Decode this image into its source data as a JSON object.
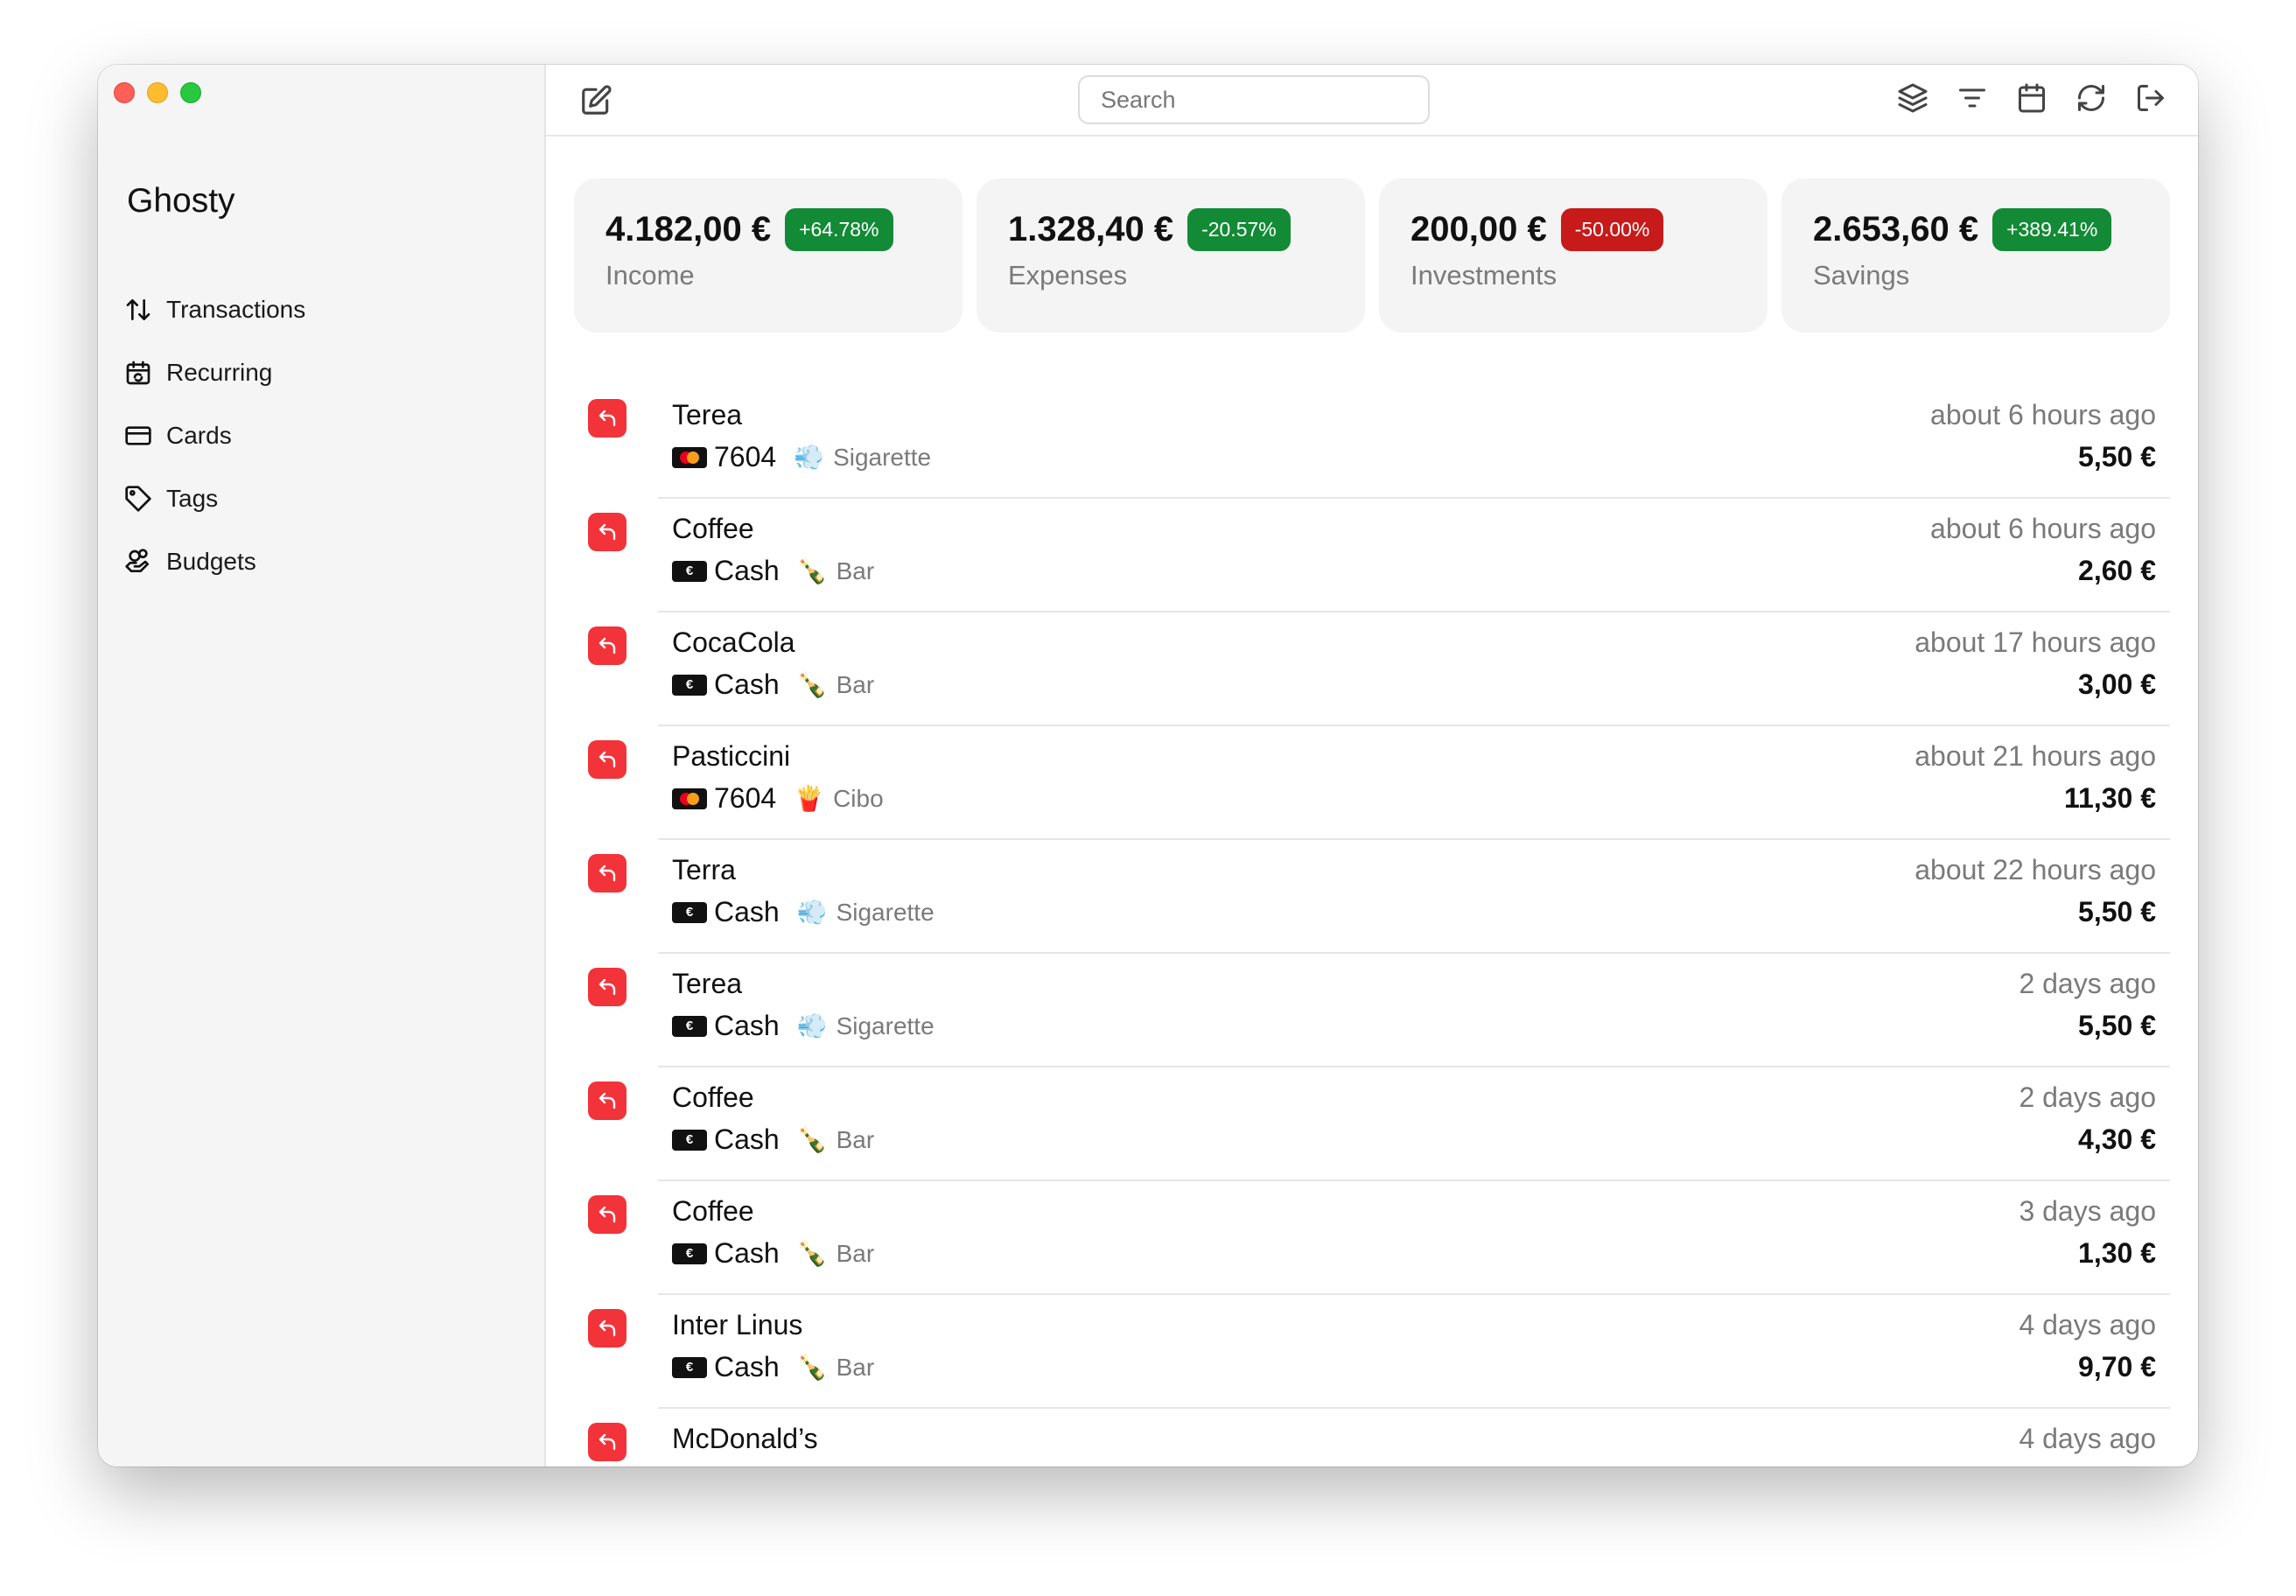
{
  "app": {
    "title": "Ghosty"
  },
  "sidebar": {
    "items": [
      {
        "label": "Transactions",
        "icon": "arrows-up-down-icon"
      },
      {
        "label": "Recurring",
        "icon": "calendar-repeat-icon"
      },
      {
        "label": "Cards",
        "icon": "credit-card-icon"
      },
      {
        "label": "Tags",
        "icon": "tag-icon"
      },
      {
        "label": "Budgets",
        "icon": "coins-hand-icon"
      }
    ]
  },
  "toolbar": {
    "search_placeholder": "Search",
    "icons": [
      "layers-icon",
      "filter-icon",
      "calendar-icon",
      "refresh-icon",
      "logout-icon"
    ]
  },
  "stats": [
    {
      "amount": "4.182,00 €",
      "change": "+64.78%",
      "label": "Income",
      "badge_color": "#138a36"
    },
    {
      "amount": "1.328,40 €",
      "change": "-20.57%",
      "label": "Expenses",
      "badge_color": "#138a36"
    },
    {
      "amount": "200,00 €",
      "change": "-50.00%",
      "label": "Investments",
      "badge_color": "#c71a1a"
    },
    {
      "amount": "2.653,60 €",
      "change": "+389.41%",
      "label": "Savings",
      "badge_color": "#138a36"
    }
  ],
  "transactions": [
    {
      "name": "Terea",
      "card": "mastercard",
      "method": "7604",
      "tag_emoji": "💨",
      "tag": "Sigarette",
      "time": "about 6 hours ago",
      "amount": "5,50 €"
    },
    {
      "name": "Coffee",
      "card": "cash",
      "method": "Cash",
      "tag_emoji": "🍾",
      "tag": "Bar",
      "time": "about 6 hours ago",
      "amount": "2,60 €"
    },
    {
      "name": "CocaCola",
      "card": "cash",
      "method": "Cash",
      "tag_emoji": "🍾",
      "tag": "Bar",
      "time": "about 17 hours ago",
      "amount": "3,00 €"
    },
    {
      "name": "Pasticcini",
      "card": "mastercard",
      "method": "7604",
      "tag_emoji": "🍟",
      "tag": "Cibo",
      "time": "about 21 hours ago",
      "amount": "11,30 €"
    },
    {
      "name": "Terra",
      "card": "cash",
      "method": "Cash",
      "tag_emoji": "💨",
      "tag": "Sigarette",
      "time": "about 22 hours ago",
      "amount": "5,50 €"
    },
    {
      "name": "Terea",
      "card": "cash",
      "method": "Cash",
      "tag_emoji": "💨",
      "tag": "Sigarette",
      "time": "2 days ago",
      "amount": "5,50 €"
    },
    {
      "name": "Coffee",
      "card": "cash",
      "method": "Cash",
      "tag_emoji": "🍾",
      "tag": "Bar",
      "time": "2 days ago",
      "amount": "4,30 €"
    },
    {
      "name": "Coffee",
      "card": "cash",
      "method": "Cash",
      "tag_emoji": "🍾",
      "tag": "Bar",
      "time": "3 days ago",
      "amount": "1,30 €"
    },
    {
      "name": "Inter Linus",
      "card": "cash",
      "method": "Cash",
      "tag_emoji": "🍾",
      "tag": "Bar",
      "time": "4 days ago",
      "amount": "9,70 €"
    },
    {
      "name": "McDonald’s",
      "card": "",
      "method": "",
      "tag_emoji": "",
      "tag": "",
      "time": "4 days ago",
      "amount": ""
    }
  ]
}
